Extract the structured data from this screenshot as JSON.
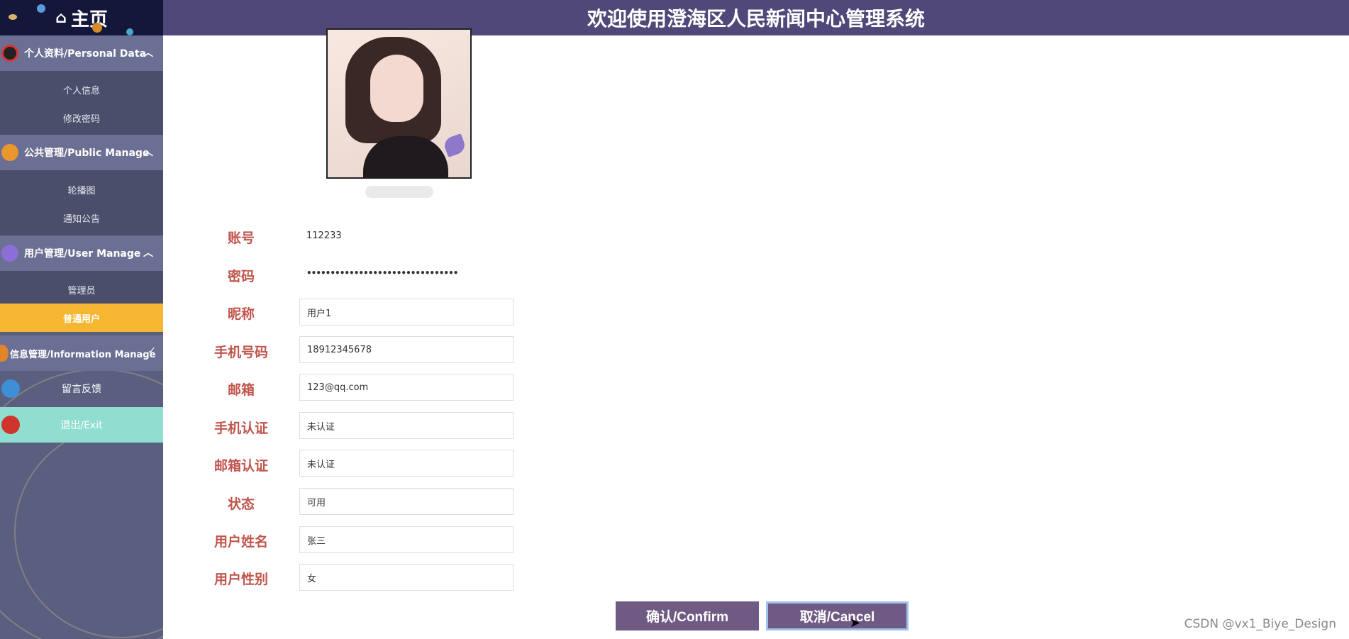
{
  "brand": {
    "title": "主页",
    "home_icon": "home-icon"
  },
  "header": {
    "title": "欢迎使用澄海区人民新闻中心管理系统"
  },
  "sidebar": {
    "groups": [
      {
        "label": "个人资料/Personal Data",
        "icon": "atom-icon",
        "items": [
          "个人信息",
          "修改密码"
        ]
      },
      {
        "label": "公共管理/Public Manage",
        "icon": "planet-icon",
        "items": [
          "轮播图",
          "通知公告"
        ]
      },
      {
        "label": "用户管理/User Manage",
        "icon": "gem-icon",
        "items": [
          "管理员",
          "普通用户"
        ]
      },
      {
        "label": "信息管理/Information Manage",
        "icon": "moon-icon",
        "items": []
      }
    ],
    "feedback": "留言反馈",
    "exit": "退出/Exit",
    "active_item": "普通用户"
  },
  "form": {
    "account_label": "账号",
    "account_value": "112233",
    "password_label": "密码",
    "password_value": "••••••••••••••••••••••••••••••••",
    "nickname_label": "昵称",
    "nickname_value": "用户1",
    "phone_label": "手机号码",
    "phone_value": "18912345678",
    "email_label": "邮箱",
    "email_value": "123@qq.com",
    "phone_verify_label": "手机认证",
    "phone_verify_value": "未认证",
    "email_verify_label": "邮箱认证",
    "email_verify_value": "未认证",
    "status_label": "状态",
    "status_value": "可用",
    "realname_label": "用户姓名",
    "realname_value": "张三",
    "gender_label": "用户性别",
    "gender_value": "女"
  },
  "buttons": {
    "confirm": "确认/Confirm",
    "cancel": "取消/Cancel"
  },
  "watermark": "CSDN @vx1_Biye_Design",
  "colors": {
    "header": "#4f4878",
    "sidebar": "#5a5f80",
    "active": "#f5b731",
    "exit": "#8fded0",
    "label": "#c0554d",
    "button": "#6f5a84"
  }
}
